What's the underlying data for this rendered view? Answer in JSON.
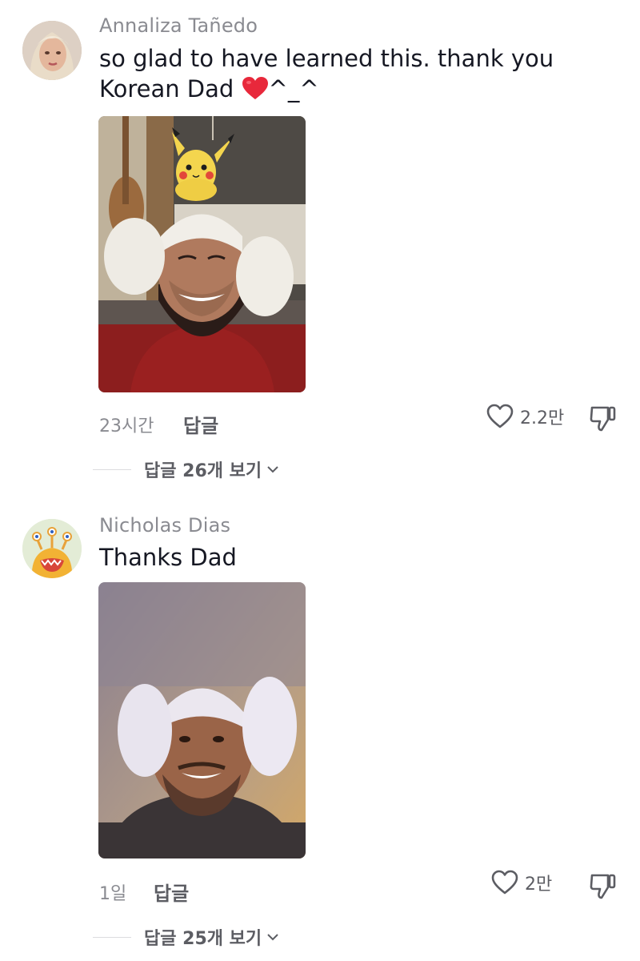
{
  "comments": [
    {
      "username": "Annaliza Tañedo",
      "text_line1": "so glad to have learned this. thank you",
      "text_line2_prefix": "Korean Dad ",
      "text_line2_suffix": "^_^",
      "time": "23시간",
      "reply_label": "답글",
      "like_count": "2.2만",
      "view_replies": "답글 26개 보기"
    },
    {
      "username": "Nicholas Dias",
      "text": "Thanks Dad",
      "time": "1일",
      "reply_label": "답글",
      "like_count": "2만",
      "view_replies": "답글 25개 보기"
    }
  ],
  "colors": {
    "muted_text": "#8a8b91",
    "action_text": "#5c5d63",
    "heart_emoji": "#e8283b"
  }
}
